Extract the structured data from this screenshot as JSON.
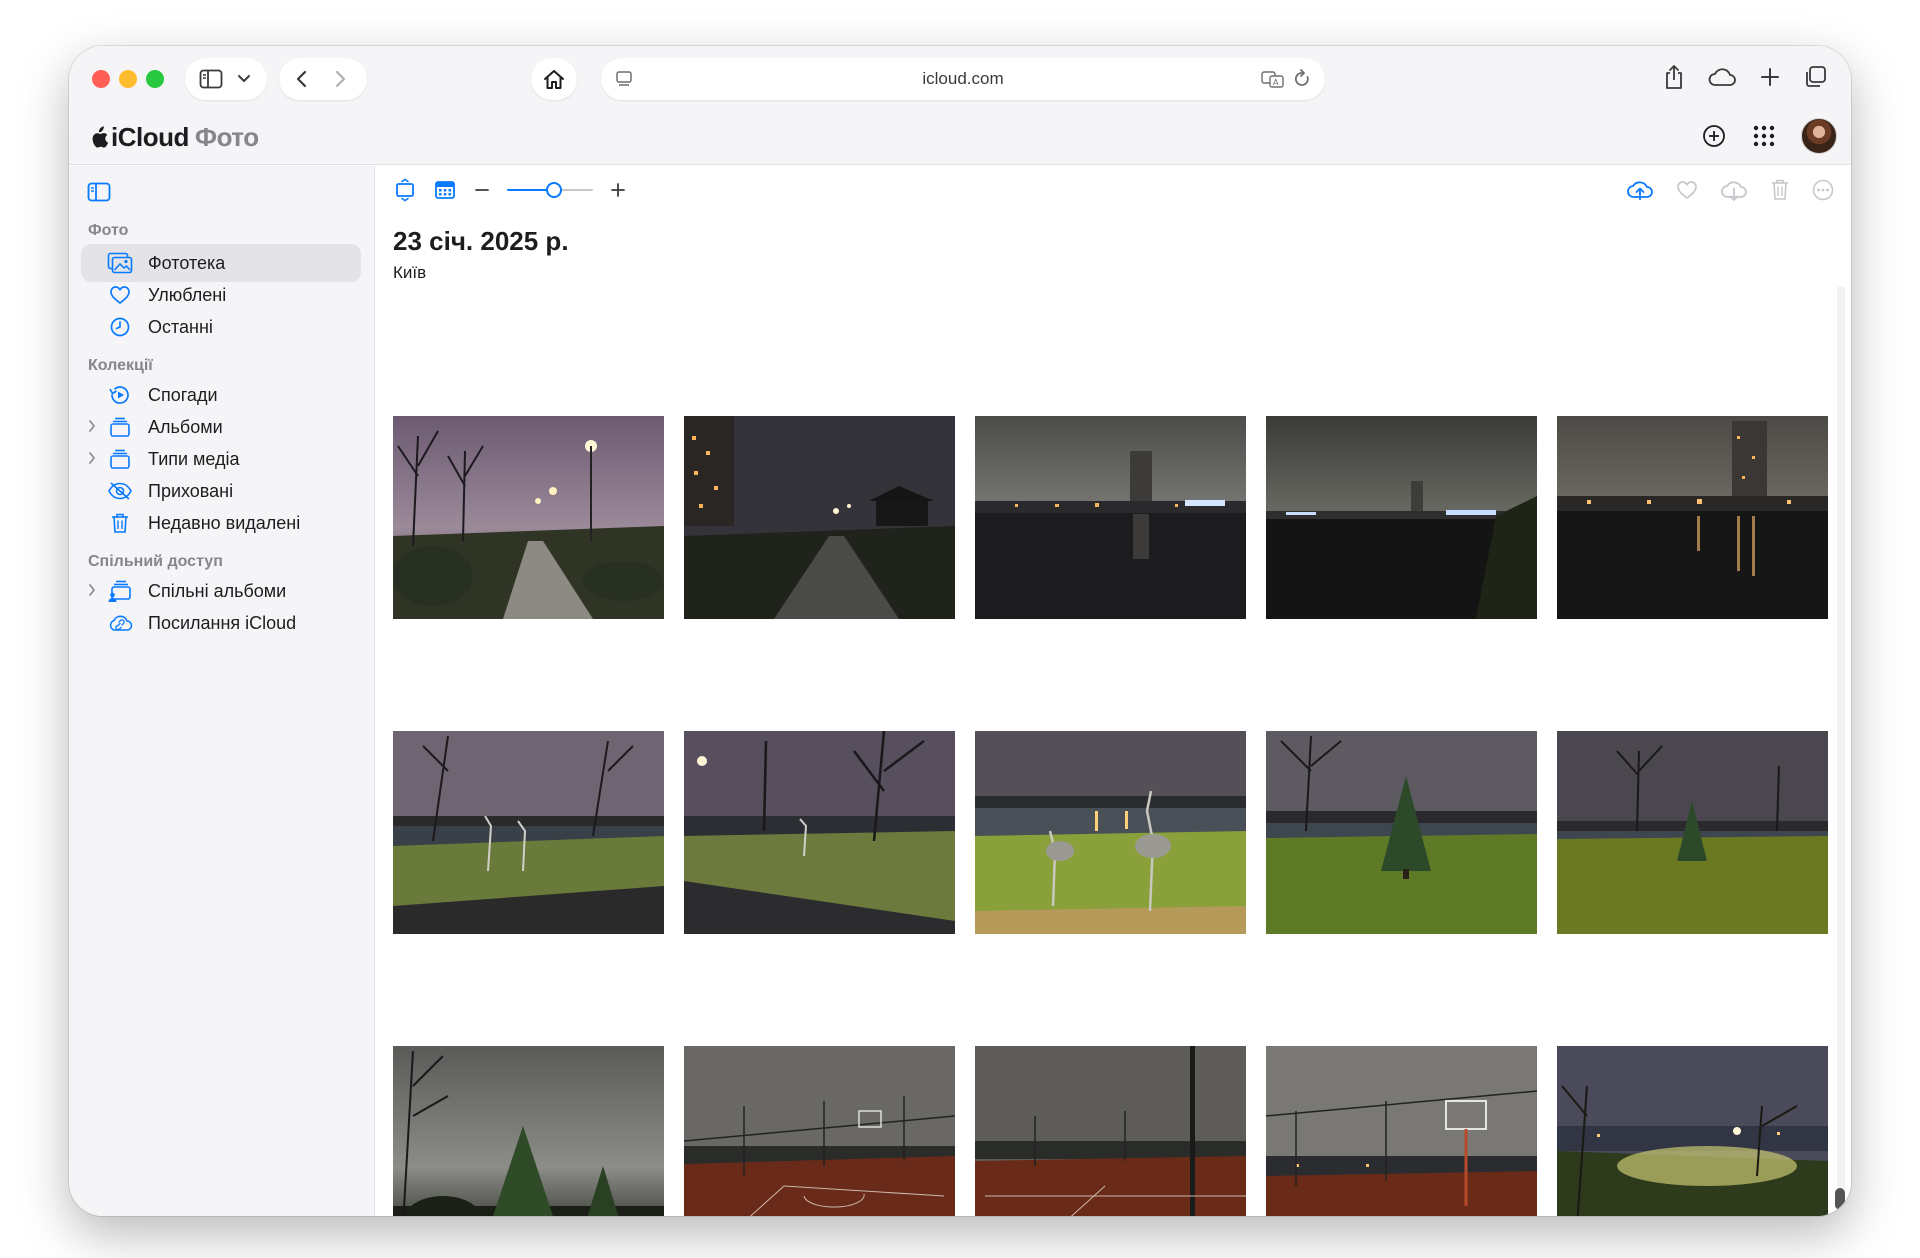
{
  "browser": {
    "url": "icloud.com"
  },
  "app": {
    "brand": "iCloud",
    "section": "Фото"
  },
  "sidebar": {
    "section_photos": "Фото",
    "section_collections": "Колекції",
    "section_shared": "Спільний доступ",
    "items": [
      {
        "label": "Фототека",
        "icon": "photo-library-icon",
        "active": true
      },
      {
        "label": "Улюблені",
        "icon": "heart-icon"
      },
      {
        "label": "Останні",
        "icon": "clock-icon"
      },
      {
        "label": "Спогади",
        "icon": "memories-icon"
      },
      {
        "label": "Альбоми",
        "icon": "album-stack-icon",
        "expandable": true
      },
      {
        "label": "Типи медіа",
        "icon": "media-types-icon",
        "expandable": true
      },
      {
        "label": "Приховані",
        "icon": "eye-slash-icon"
      },
      {
        "label": "Недавно видалені",
        "icon": "trash-icon"
      },
      {
        "label": "Спільні альбоми",
        "icon": "shared-album-icon",
        "expandable": true
      },
      {
        "label": "Посилання iCloud",
        "icon": "icloud-link-icon"
      }
    ]
  },
  "main": {
    "date_title": "23 січ. 2025 р.",
    "location": "Київ",
    "zoom_level": 0.55,
    "accent": "#0a7aff"
  },
  "photos": [
    {
      "scene": "park-path-lamps"
    },
    {
      "scene": "path-gazebo"
    },
    {
      "scene": "lake-tower-lights"
    },
    {
      "scene": "lake-fog"
    },
    {
      "scene": "lake-city-reflection"
    },
    {
      "scene": "stork-sculptures-lake"
    },
    {
      "scene": "stork-sculptures-road"
    },
    {
      "scene": "stork-sculptures-closeup"
    },
    {
      "scene": "fir-tree-lawn"
    },
    {
      "scene": "fir-tree-field"
    },
    {
      "scene": "fir-tree-dark-sky"
    },
    {
      "scene": "basketball-court-wide"
    },
    {
      "scene": "basketball-court-pole"
    },
    {
      "scene": "basketball-court-hoop"
    },
    {
      "scene": "willow-lamps-lake"
    }
  ]
}
